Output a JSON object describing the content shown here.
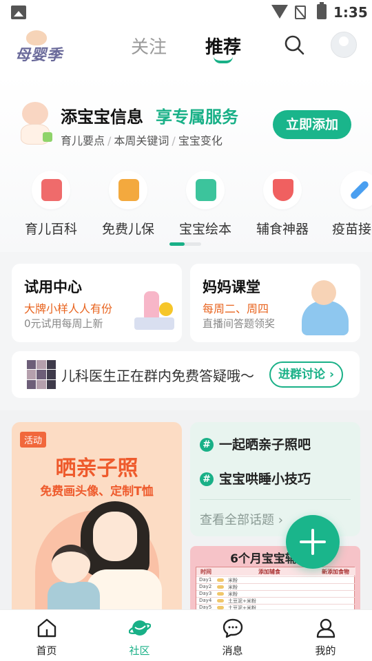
{
  "status_bar": {
    "time": "1:35"
  },
  "top_nav": {
    "logo_text": "母婴季",
    "tabs": [
      {
        "label": "关注",
        "active": false
      },
      {
        "label": "推荐",
        "active": true
      }
    ],
    "accent_color": "#19b087"
  },
  "baby_banner": {
    "title": "添宝宝信息",
    "accent": "享专属服务",
    "subtitles": [
      "育儿要点",
      "本周关键词",
      "宝宝变化"
    ],
    "button_label": "立即添加"
  },
  "categories": [
    {
      "label": "育儿百科",
      "icon": "book-search-icon",
      "color": "#ef6b6b"
    },
    {
      "label": "免费儿保",
      "icon": "chart-growth-icon",
      "color": "#f3a93e"
    },
    {
      "label": "宝宝绘本",
      "icon": "picture-book-icon",
      "color": "#3cc49c"
    },
    {
      "label": "辅食神器",
      "icon": "food-bowl-icon",
      "color": "#f06060"
    },
    {
      "label": "疫苗接",
      "icon": "vaccine-syringe-icon",
      "color": "#4a9ff0"
    }
  ],
  "cards": {
    "trial": {
      "title": "试用中心",
      "highlight": "大牌小样人人有份",
      "sub": "0元试用每周上新"
    },
    "class": {
      "title": "妈妈课堂",
      "highlight": "每周二、周四",
      "sub": "直播间答题领奖"
    }
  },
  "doctor_bar": {
    "text": "儿科医生正在群内免费答疑哦～",
    "button_label": "进群讨论"
  },
  "activity": {
    "tag": "活动",
    "title": "晒亲子照",
    "subtitle": "免费画头像、定制T恤"
  },
  "topics": {
    "items": [
      "一起晒亲子照吧",
      "宝宝哄睡小技巧"
    ],
    "view_all": "查看全部话题"
  },
  "recipe": {
    "title": "6个月宝宝辅食单",
    "headers": [
      "时间",
      "添加辅食",
      "新添加食物"
    ],
    "rows": [
      {
        "day": "Day1",
        "food": "米粉"
      },
      {
        "day": "Day2",
        "food": "米粉"
      },
      {
        "day": "Day3",
        "food": "米粉"
      },
      {
        "day": "Day4",
        "food": "土豆泥+米粉"
      },
      {
        "day": "Day5",
        "food": "土豆泥+米粉"
      }
    ]
  },
  "bottom_nav": [
    {
      "label": "首页",
      "icon": "home-icon",
      "active": false
    },
    {
      "label": "社区",
      "icon": "planet-icon",
      "active": true
    },
    {
      "label": "消息",
      "icon": "message-icon",
      "active": false
    },
    {
      "label": "我的",
      "icon": "profile-icon",
      "active": false
    }
  ]
}
